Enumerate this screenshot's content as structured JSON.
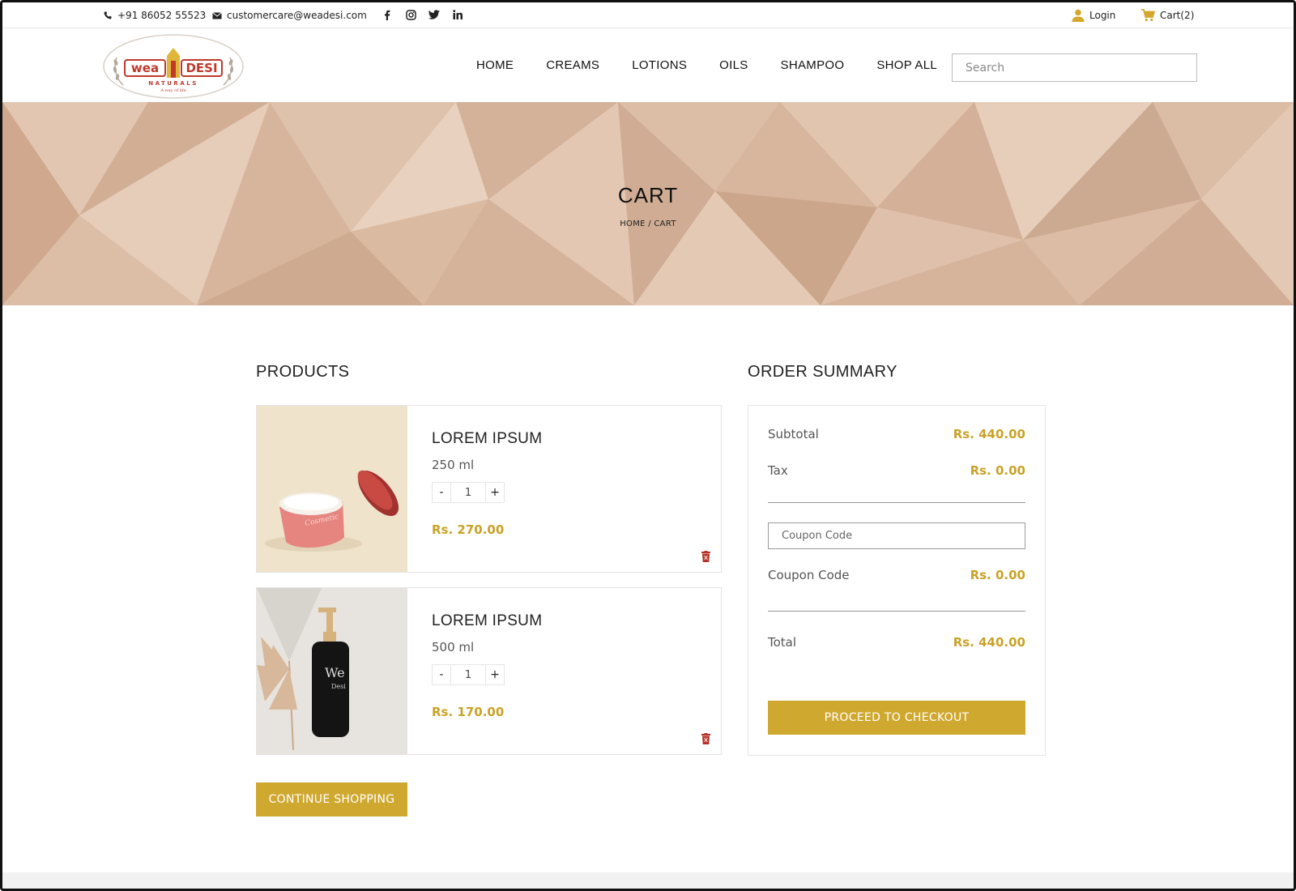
{
  "topbar": {
    "phone": "+91 86052 55523",
    "email": "customercare@weadesi.com",
    "social": [
      "facebook-icon",
      "instagram-icon",
      "twitter-icon",
      "linkedin-icon"
    ],
    "login_label": "Login",
    "cart_label": "Cart(2)"
  },
  "header": {
    "logo_text": "We A Desi Naturals",
    "nav": [
      "HOME",
      "CREAMS",
      "LOTIONS",
      "OILS",
      "SHAMPOO",
      "SHOP ALL"
    ],
    "search_placeholder": "Search"
  },
  "hero": {
    "title": "CART",
    "breadcrumb": "HOME / CART"
  },
  "products": {
    "title": "PRODUCTS",
    "items": [
      {
        "name": "LOREM IPSUM",
        "size": "250 ml",
        "qty": "1",
        "price": "Rs. 270.00"
      },
      {
        "name": "LOREM IPSUM",
        "size": "500 ml",
        "qty": "1",
        "price": "Rs. 170.00"
      }
    ],
    "qty_minus": "-",
    "qty_plus": "+",
    "continue_label": "CONTINUE SHOPPING"
  },
  "summary": {
    "title": "ORDER SUMMARY",
    "subtotal_label": "Subtotal",
    "subtotal_value": "Rs. 440.00",
    "tax_label": "Tax",
    "tax_value": "Rs. 0.00",
    "coupon_placeholder": "Coupon Code",
    "coupon_label": "Coupon Code",
    "coupon_value": "Rs. 0.00",
    "total_label": "Total",
    "total_value": "Rs. 440.00",
    "checkout_label": "PROCEED TO CHECKOUT"
  },
  "colors": {
    "accent_gold": "#cfa830",
    "price_gold": "#c9a227",
    "hero_bg": "#d8b8a0"
  }
}
